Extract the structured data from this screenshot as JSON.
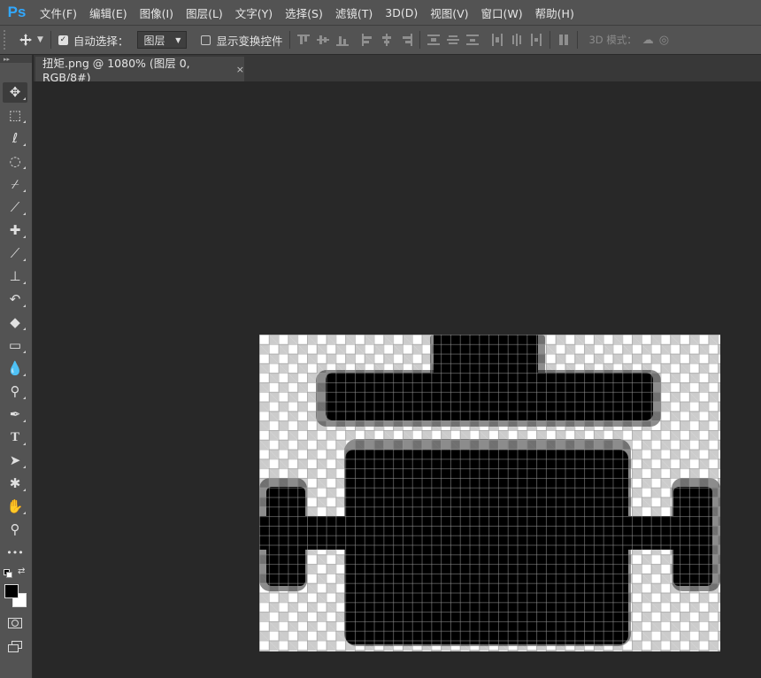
{
  "app": {
    "logo": "Ps",
    "menu": [
      "文件(F)",
      "编辑(E)",
      "图像(I)",
      "图层(L)",
      "文字(Y)",
      "选择(S)",
      "滤镜(T)",
      "3D(D)",
      "视图(V)",
      "窗口(W)",
      "帮助(H)"
    ]
  },
  "options": {
    "auto_select_label": "自动选择：",
    "auto_select_checked": true,
    "auto_select_value": "图层",
    "show_transform_label": "显示变换控件",
    "show_transform_checked": false,
    "mode_3d_label": "3D 模式："
  },
  "document": {
    "tab_title": "扭矩.png @ 1080% (图层 0, RGB/8#)",
    "close_glyph": "×"
  },
  "tools": [
    {
      "name": "move-tool",
      "icon": "move-icon",
      "glyph": "✥"
    },
    {
      "name": "marquee-tool",
      "icon": "rect-marquee-icon",
      "glyph": "⬚"
    },
    {
      "name": "lasso-tool",
      "icon": "lasso-icon",
      "glyph": "ℓ"
    },
    {
      "name": "quick-select-tool",
      "icon": "quick-select-icon",
      "glyph": "◌"
    },
    {
      "name": "crop-tool",
      "icon": "crop-icon",
      "glyph": "⌿"
    },
    {
      "name": "eyedropper-tool",
      "icon": "eyedropper-icon",
      "glyph": "⟋"
    },
    {
      "name": "healing-tool",
      "icon": "bandage-icon",
      "glyph": "✚"
    },
    {
      "name": "brush-tool",
      "icon": "brush-icon",
      "glyph": "⟋"
    },
    {
      "name": "stamp-tool",
      "icon": "stamp-icon",
      "glyph": "⊥"
    },
    {
      "name": "history-brush-tool",
      "icon": "history-brush-icon",
      "glyph": "↶"
    },
    {
      "name": "eraser-tool",
      "icon": "eraser-icon",
      "glyph": "◆"
    },
    {
      "name": "gradient-tool",
      "icon": "gradient-icon",
      "glyph": "▭"
    },
    {
      "name": "blur-tool",
      "icon": "drop-icon",
      "glyph": "💧"
    },
    {
      "name": "dodge-tool",
      "icon": "dodge-icon",
      "glyph": "⚲"
    },
    {
      "name": "pen-tool",
      "icon": "pen-icon",
      "glyph": "✒"
    },
    {
      "name": "type-tool",
      "icon": "type-icon",
      "glyph": "T"
    },
    {
      "name": "path-select-tool",
      "icon": "arrow-cursor-icon",
      "glyph": "➤"
    },
    {
      "name": "shape-tool",
      "icon": "custom-shape-icon",
      "glyph": "✱"
    },
    {
      "name": "hand-tool",
      "icon": "hand-icon",
      "glyph": "✋"
    },
    {
      "name": "zoom-tool",
      "icon": "zoom-icon",
      "glyph": "⚲"
    },
    {
      "name": "more-tools",
      "icon": "ellipsis-icon",
      "glyph": "•••"
    }
  ],
  "colors": {
    "foreground": "#000000",
    "background": "#ffffff",
    "accent": "#31a8ff"
  }
}
